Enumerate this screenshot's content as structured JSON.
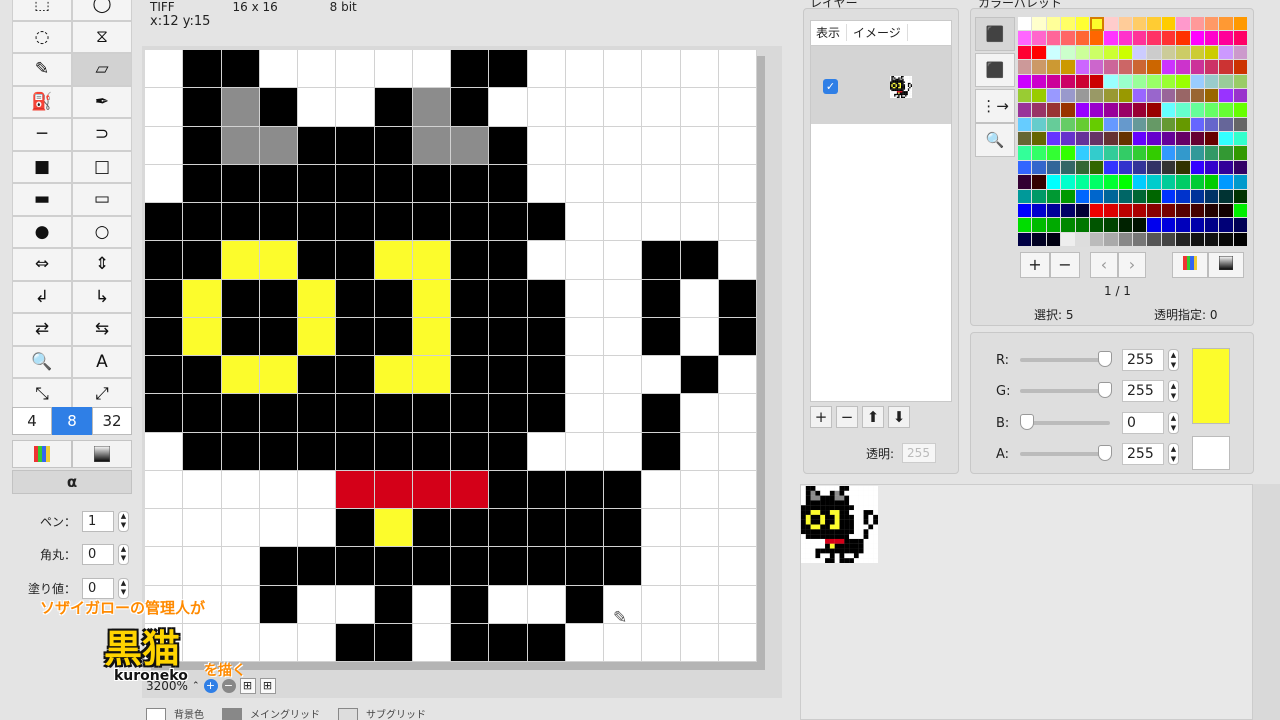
{
  "info": {
    "format": "TIFF",
    "size": "16 x 16",
    "depth": "8 bit",
    "coord": "x:12 y:15"
  },
  "tools": [
    "marquee-rect-icon",
    "marquee-ellipse-icon",
    "lasso-icon",
    "magic-lasso-icon",
    "pencil-icon",
    "eraser-icon",
    "paint-bucket-icon",
    "eyedropper-icon",
    "line-icon",
    "curve-icon",
    "filled-rect-icon",
    "rect-icon",
    "filled-rounded-rect-icon",
    "rounded-rect-icon",
    "filled-ellipse-icon",
    "ellipse-icon",
    "flip-horizontal-icon",
    "flip-vertical-icon",
    "rotate-left-icon",
    "rotate-right-icon",
    "swap-colors-icon",
    "swap-colors-alt-icon",
    "zoom-icon",
    "text-icon",
    "select-transform-icon",
    "select-transform-alt-icon"
  ],
  "tool_glyphs": [
    "⬚",
    "◯",
    "◌",
    "⧖",
    "✎",
    "▱",
    "⛽",
    "✒",
    "─",
    "⊃",
    "■",
    "□",
    "▬",
    "▭",
    "●",
    "○",
    "⇔",
    "⇕",
    "↲",
    "↳",
    "⇄",
    "⇆",
    "🔍",
    "A",
    "⤡",
    "⤢"
  ],
  "bits": [
    "4",
    "8",
    "32"
  ],
  "alpha_label": "α",
  "fields": [
    {
      "label": "ペン：",
      "value": "1"
    },
    {
      "label": "角丸：",
      "value": "0"
    },
    {
      "label": "塗り値：",
      "value": "0"
    }
  ],
  "zoom": "3200%",
  "grid_options": [
    "背景色",
    "メイングリッド",
    "サブグリッド"
  ],
  "layers": {
    "title": "レイヤー",
    "col_show": "表示",
    "col_image": "イメージ",
    "opacity_label": "透明:",
    "opacity_value": "255"
  },
  "palette": {
    "title": "カラーパレット",
    "page": "1 / 1",
    "selection": "選択: 5",
    "transparent": "透明指定: 0"
  },
  "color": {
    "r": {
      "label": "R:",
      "value": "255"
    },
    "g": {
      "label": "G:",
      "value": "255"
    },
    "b": {
      "label": "B:",
      "value": "0"
    },
    "a": {
      "label": "A:",
      "value": "255"
    },
    "current_hex": "#fcfc2c"
  },
  "caption": {
    "line1": "ソザイガローの管理人が",
    "title": "黒猫",
    "suffix": "を描く",
    "romaji": "kuroneko"
  },
  "pixel_art": {
    "legend": {
      "0": "#ffffff",
      "1": "#000000",
      "2": "#8c8c8c",
      "3": "#fcfc2c",
      "4": "#d40018"
    },
    "rows": [
      "0110000011000000",
      "0121001210000000",
      "0122111221000000",
      "0111111111000000",
      "1111111111100000",
      "1133113311000110",
      "1311311311100101",
      "1311311311100101",
      "1133113311100010",
      "1111111111100100",
      "0111111111000100",
      "0000044441111000",
      "0000013111111000",
      "0001111111111000",
      "0001001010010000",
      "0000011011100000"
    ]
  }
}
